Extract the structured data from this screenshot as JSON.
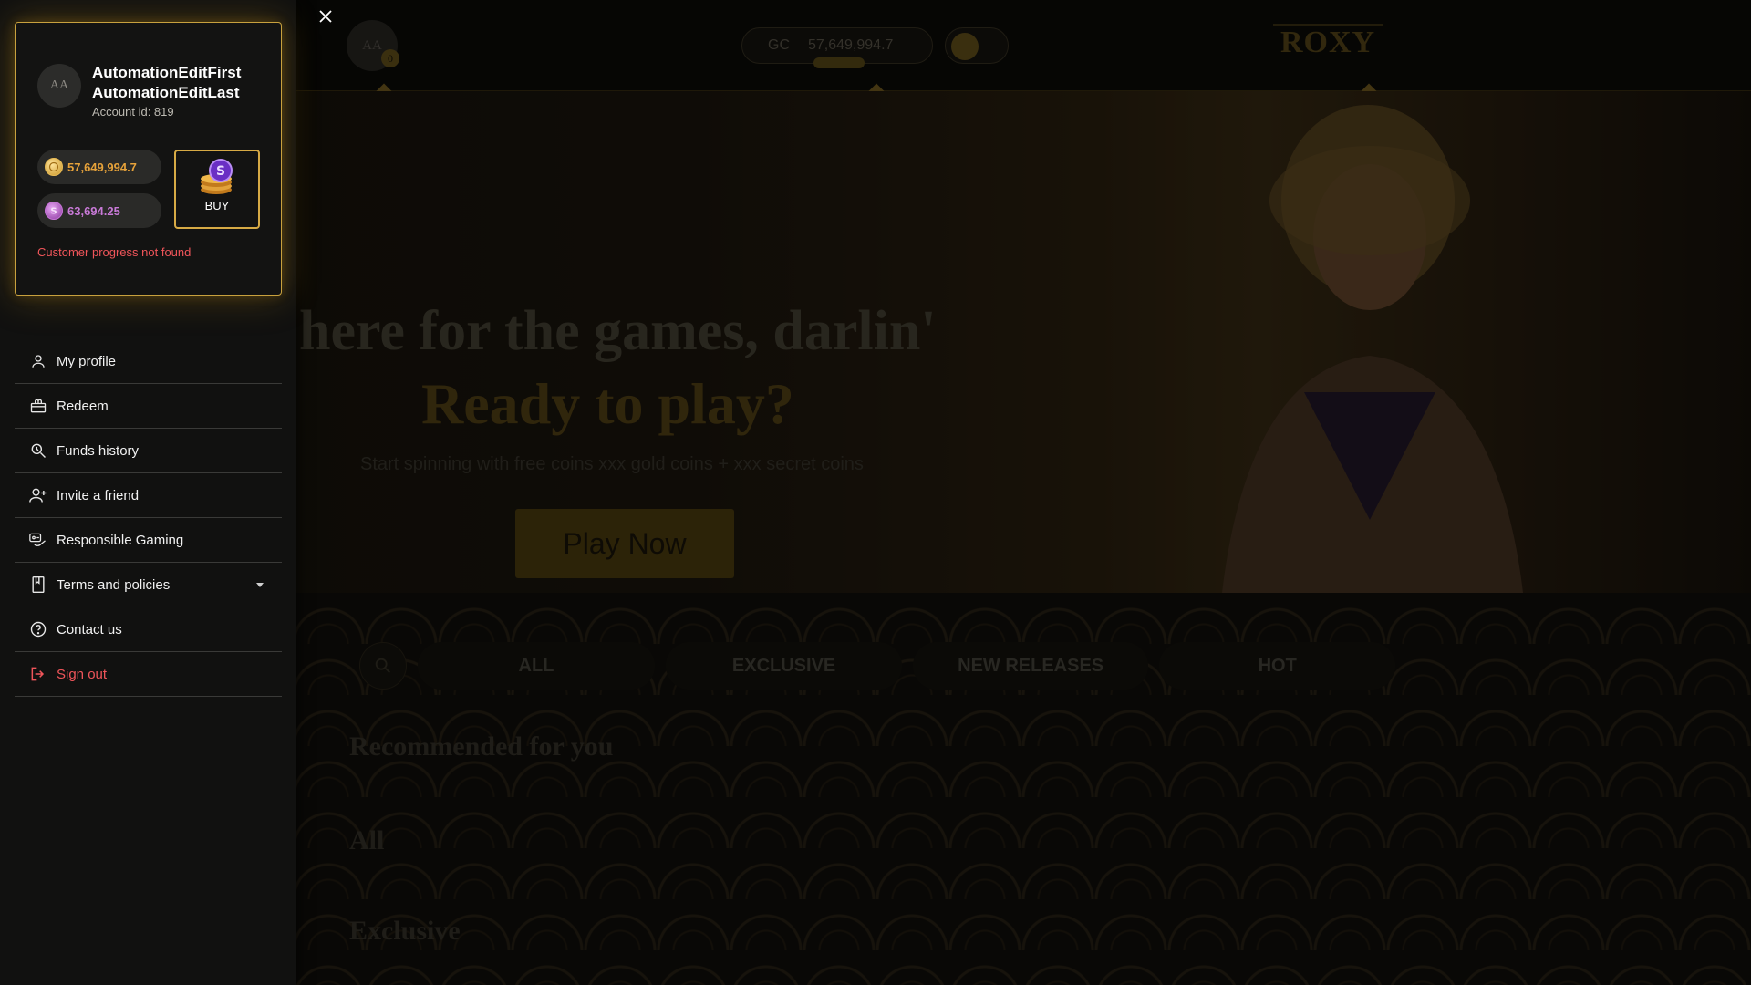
{
  "site": {
    "header": {
      "avatar_initials": "AA",
      "notification_count": "0",
      "balance_currency": "GC",
      "balance_value": "57,649,994.7",
      "logo_text": "ROXY"
    },
    "hero": {
      "title": "here for the games, darlin'",
      "subtitle": "Ready to play?",
      "description": "Start spinning with free coins xxx gold coins + xxx secret coins",
      "cta_label": "Play Now"
    },
    "tabs": [
      "ALL",
      "EXCLUSIVE",
      "NEW RELEASES",
      "HOT"
    ],
    "sections": [
      "Recommended for you",
      "All",
      "Exclusive"
    ]
  },
  "drawer": {
    "profile": {
      "avatar_initials": "AA",
      "first_name": "AutomationEditFirst",
      "last_name": "AutomationEditLast",
      "account_id": "Account id: 819",
      "gold_coins": "57,649,994.7",
      "sweep_coins": "63,694.25",
      "buy_label": "BUY",
      "progress_error": "Customer progress not found"
    },
    "menu": [
      {
        "label": "My profile",
        "icon": "user-icon"
      },
      {
        "label": "Redeem",
        "icon": "gift-icon"
      },
      {
        "label": "Funds history",
        "icon": "history-search-icon"
      },
      {
        "label": "Invite a friend",
        "icon": "add-user-icon"
      },
      {
        "label": "Responsible Gaming",
        "icon": "responsible-gaming-icon"
      },
      {
        "label": "Terms and policies",
        "icon": "bookmark-icon"
      },
      {
        "label": "Contact us",
        "icon": "help-circle-icon"
      },
      {
        "label": "Sign out",
        "icon": "sign-out-icon"
      }
    ]
  },
  "colors": {
    "accent_gold": "#c8a13e",
    "gold_coin_text": "#e6a23a",
    "sweep_coin_text": "#c97ad8",
    "error_red": "#f0555a",
    "drawer_bg": "#111110"
  }
}
